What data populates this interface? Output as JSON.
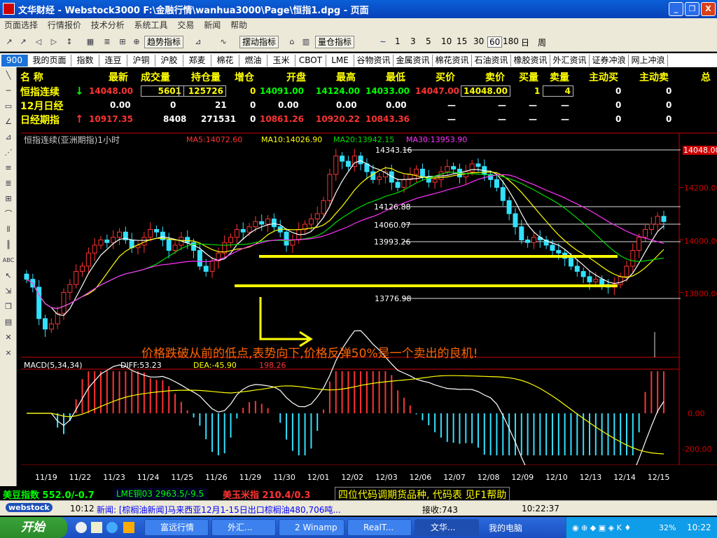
{
  "window": {
    "title": "文华财经 - Webstock3000    F:\\金融行情\\wanhua3000\\Page\\恒指1.dpg - 页面",
    "buttons": [
      "_",
      "❐",
      "X"
    ]
  },
  "menu": [
    "页面选择",
    "行情报价",
    "技术分析",
    "系统工具",
    "交易",
    "新闻",
    "帮助"
  ],
  "toolbar": {
    "buttons": [
      "趋势指标",
      "摆动指标",
      "量仓指标"
    ],
    "periods": [
      "1",
      "3",
      "5",
      "10",
      "15",
      "30",
      "60",
      "180",
      "日",
      "周"
    ],
    "selected_period": "60"
  },
  "tabs": [
    "900",
    "我的页面",
    "指数",
    "连豆",
    "沪铜",
    "沪胶",
    "郑麦",
    "棉花",
    "燃油",
    "玉米",
    "CBOT",
    "LME",
    "谷物资讯",
    "金属资讯",
    "棉花资讯",
    "石油资讯",
    "橡胶资讯",
    "外汇资讯",
    "证券冲浪",
    "网上冲浪"
  ],
  "quote_table": {
    "headers": [
      "名 称",
      "最新",
      "成交量",
      "持仓量",
      "增仓",
      "开盘",
      "最高",
      "最低",
      "买价",
      "卖价",
      "买量",
      "卖量",
      "主动买",
      "主动卖",
      "总"
    ],
    "rows": [
      {
        "name": "恒指连续",
        "arrow": "↓",
        "latest": "14048.00",
        "volume": "5601",
        "oi": "125726",
        "inc": "0",
        "open": "14091.00",
        "high": "14124.00",
        "low": "14033.00",
        "bid": "14047.00",
        "ask": "14048.00",
        "bidvol": "1",
        "askvol": "4",
        "abuy": "0",
        "asell": "0"
      },
      {
        "name": "12月日经",
        "arrow": "",
        "latest": "0.00",
        "volume": "0",
        "oi": "21",
        "inc": "0",
        "open": "0.00",
        "high": "0.00",
        "low": "0.00",
        "bid": "—",
        "ask": "—",
        "bidvol": "—",
        "askvol": "—",
        "abuy": "0",
        "asell": "0"
      },
      {
        "name": "日经期指",
        "arrow": "↑",
        "latest": "10917.35",
        "volume": "8408",
        "oi": "271531",
        "inc": "0",
        "open": "10861.26",
        "high": "10920.22",
        "low": "10843.36",
        "bid": "—",
        "ask": "—",
        "bidvol": "—",
        "askvol": "—",
        "abuy": "0",
        "asell": "0"
      }
    ]
  },
  "chart_data": {
    "type": "candlestick",
    "title": "恒指连续(亚洲期指)1小时",
    "ma_labels": {
      "ma5": "MA5:14072.60",
      "ma10": "MA10:14026.90",
      "ma20": "MA20:13942.15",
      "ma30": "MA30:13953.90"
    },
    "price_axis": [
      "14048.00",
      "14200.00",
      "14000.00",
      "13800.00"
    ],
    "levels": [
      "14343.16",
      "14126.88",
      "14060.07",
      "13993.26",
      "13776.98"
    ],
    "annotation": "价格跌破从前的低点,表势向下,价格反弹50%是一个卖出的良机!",
    "macd_label": "MACD(5,34,34)",
    "diff_label": "DIFF:53.23",
    "dea_label": "DEA:-45.90",
    "macd_value": "198.26",
    "macd_axis": [
      "0.00",
      "-200.00"
    ],
    "x_labels": [
      "11/19",
      "11/22",
      "11/23",
      "11/24",
      "11/25",
      "11/26",
      "11/29",
      "11/30",
      "12/01",
      "12/02",
      "12/03",
      "12/06",
      "12/07",
      "12/08",
      "12/09",
      "12/10",
      "12/13",
      "12/14",
      "12/15"
    ],
    "close_series": [
      13850,
      13820,
      13700,
      13660,
      13680,
      13720,
      13800,
      13830,
      13880,
      13900,
      13950,
      13980,
      14000,
      13990,
      14010,
      14030,
      14000,
      13970,
      13980,
      14010,
      14040,
      14030,
      14000,
      13960,
      13980,
      14010,
      13990,
      13960,
      13900,
      13880,
      13920,
      13950,
      13990,
      14010,
      14040,
      14030,
      14050,
      14070,
      14060,
      14080,
      14050,
      14030,
      13980,
      14000,
      14040,
      14060,
      14080,
      14100,
      14150,
      14250,
      14320,
      14300,
      14280,
      14320,
      14290,
      14260,
      14230,
      14240,
      14260,
      14220,
      14200,
      14230,
      14250,
      14270,
      14240,
      14220,
      14230,
      14260,
      14280,
      14270,
      14240,
      14260,
      14290,
      14280,
      14250,
      14230,
      14200,
      14150,
      14100,
      14050,
      14000,
      13990,
      14010,
      14000,
      13980,
      13960,
      13950,
      13930,
      13900,
      13880,
      13860,
      13840,
      13850,
      13830,
      13820,
      13830,
      13860,
      13900,
      13960,
      14010,
      14040,
      14060,
      14090,
      14070
    ]
  },
  "status": {
    "ticker1": "美豆指数  552.0/-0.7",
    "ticker2": "LME铜03  2963.5/-9.5",
    "ticker3": "美玉米指  210.4/0.3",
    "help": "四位代码调期货品种, 代码表 见F1帮助",
    "news_time": "10:12",
    "news": "新闻: [棕榈油新闻]马来西亚12月1-15日出口棕榈油480,706吨...",
    "logo": "webstock",
    "recv": "接收:743",
    "clock": "10:22:37"
  },
  "taskbar": {
    "start": "开始",
    "tasks": [
      "富远行情",
      "外汇...",
      "2 Winamp",
      "RealT...",
      "文华..."
    ],
    "mypc": "我的电脑",
    "battery": "32%",
    "time": "10:22"
  },
  "colors": {
    "up": "#ff3333",
    "down": "#33e0ff",
    "ma5": "#ffffff",
    "ma10": "#ffff00",
    "ma20": "#00dd00",
    "ma30": "#ff33ff",
    "annotation": "#ff6600"
  }
}
